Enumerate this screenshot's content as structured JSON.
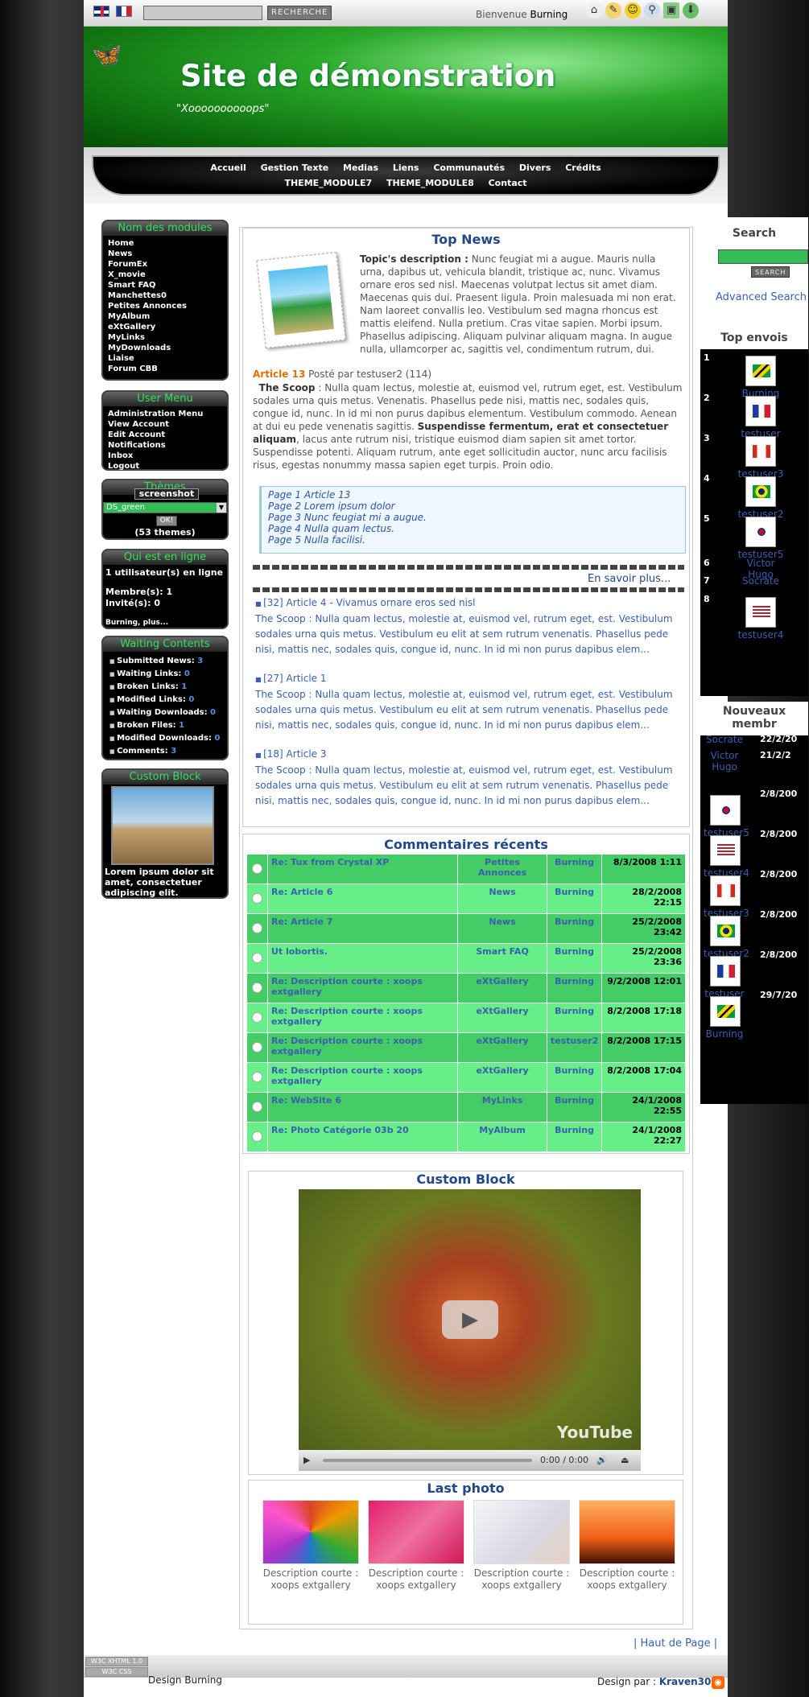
{
  "topbar": {
    "search_button": "RECHERCHE",
    "welcome_prefix": "Bienvenue",
    "welcome_user": "Burning",
    "icons": [
      "home-icon",
      "notes-icon",
      "smiley-icon",
      "search-icon",
      "image-icon",
      "download-icon"
    ]
  },
  "header": {
    "title": "Site de démonstration",
    "slogan": "\"Xoooooooooops\""
  },
  "nav": [
    "Accueil",
    "Gestion Texte",
    "Medias",
    "Liens",
    "Communautés",
    "Divers",
    "Crédits",
    "THEME_MODULE7",
    "THEME_MODULE8",
    "Contact"
  ],
  "modules": {
    "title": "Nom des modules",
    "items": [
      "Home",
      "News",
      "ForumEx",
      "X_movie",
      "Smart FAQ",
      "Manchettes0",
      "Petites Annonces",
      "MyAlbum",
      "eXtGallery",
      "MyLinks",
      "MyDownloads",
      "Liaise",
      "Forum CBB"
    ]
  },
  "usermenu": {
    "title": "User Menu",
    "items": [
      "Administration Menu",
      "View Account",
      "Edit Account",
      "Notifications",
      "Inbox",
      "Logout"
    ]
  },
  "themes": {
    "title": "Thèmes",
    "screenshot": "screenshot",
    "selected": "DS_green",
    "ok": "OK!",
    "count": "(53 themes)"
  },
  "online": {
    "title": "Qui est en ligne",
    "line1": "1 utilisateur(s) en ligne",
    "members": "Membre(s): 1",
    "guests": "Invité(s): 0",
    "users": "Burning, plus..."
  },
  "waiting": {
    "title": "Waiting Contents",
    "items": [
      {
        "label": "Submitted News:",
        "count": "3"
      },
      {
        "label": "Waiting Links:",
        "count": "0"
      },
      {
        "label": "Broken Links:",
        "count": "1"
      },
      {
        "label": "Modified Links:",
        "count": "0"
      },
      {
        "label": "Waiting Downloads:",
        "count": "0"
      },
      {
        "label": "Broken Files:",
        "count": "1"
      },
      {
        "label": "Modified Downloads:",
        "count": "0"
      },
      {
        "label": "Comments:",
        "count": "3"
      }
    ]
  },
  "customleft": {
    "title": "Custom Block",
    "text": "Lorem ipsum dolor sit amet, consectetuer adipiscing elit."
  },
  "topnews": {
    "title": "Top News",
    "desc_label": "Topic's description :",
    "desc": " Nunc feugiat mi a augue. Mauris nulla urna, dapibus ut, vehicula blandit, tristique ac, nunc. Vivamus ornare eros sed nisl. Maecenas volutpat lectus sit amet diam. Maecenas quis dui. Praesent ligula. Proin malesuada mi non erat. Nam laoreet convallis leo. Vestibulum sed magna rhoncus est mattis eleifend. Nulla pretium. Cras vitae sapien. Morbi ipsum. Phasellus adipiscing. Aliquam pulvinar aliquam magna. In augue nulla, ullamcorper ac, sagittis vel, condimentum rutrum, dui.",
    "article": "Article 13",
    "posted": " Posté par testuser2 (114)",
    "scoop_label": "The Scoop",
    "scoop": " : Nulla quam lectus, molestie at, euismod vel, rutrum eget, est. Vestibulum sodales urna quis metus. Venenatis. Phasellus pede nisi, mattis nec, sodales quis, congue id, nunc. In id mi non purus dapibus elementum. Vestibulum commodo. Aenean at dui eu pede venenatis sagittis. ",
    "scoop_bold": "Suspendisse fermentum, erat et consectetuer aliquam",
    "scoop_end": ", lacus ante rutrum nisi, tristique euismod diam sapien sit amet tortor. Suspendisse potenti. Aliquam rutrum, ante eget sollicitudin auctor, nunc arcu facilisis risus, egestas nonummy massa sapien eget turpis. Proin odio.",
    "pages": [
      "Page 1 Article 13",
      "Page 2 Lorem ipsum dolor",
      "Page 3 Nunc feugiat mi a augue.",
      "Page 4 Nulla quam lectus.",
      "Page 5 Nulla facilisi."
    ],
    "more": "En savoir plus...",
    "headlines": [
      {
        "title": "[32] Article 4 - Vivamus ornare eros sed nisl",
        "text": "The Scoop : Nulla quam lectus, molestie at, euismod vel, rutrum eget, est. Vestibulum sodales urna quis metus. Vestibulum eu elit at sem rutrum venenatis. Phasellus pede nisi, mattis nec, sodales quis, congue id, nunc. In id mi non purus dapibus elem..."
      },
      {
        "title": "[27] Article 1",
        "text": "The Scoop : Nulla quam lectus, molestie at, euismod vel, rutrum eget, est. Vestibulum sodales urna quis metus. Vestibulum eu elit at sem rutrum venenatis. Phasellus pede nisi, mattis nec, sodales quis, congue id, nunc. In id mi non purus dapibus elem..."
      },
      {
        "title": "[18] Article 3",
        "text": "The Scoop : Nulla quam lectus, molestie at, euismod vel, rutrum eget, est. Vestibulum sodales urna quis metus. Vestibulum eu elit at sem rutrum venenatis. Phasellus pede nisi, mattis nec, sodales quis, congue id, nunc. In id mi non purus dapibus elem..."
      }
    ]
  },
  "comments": {
    "title": "Commentaires récents",
    "rows": [
      {
        "title": "Re: Tux from Crystal XP",
        "module": "Petites Annonces",
        "user": "Burning",
        "date": "8/3/2008 1:11"
      },
      {
        "title": "Re: Article 6",
        "module": "News",
        "user": "Burning",
        "date": "28/2/2008 22:15"
      },
      {
        "title": "Re: Article 7",
        "module": "News",
        "user": "Burning",
        "date": "25/2/2008 23:42"
      },
      {
        "title": "Ut lobortis.",
        "module": "Smart FAQ",
        "user": "Burning",
        "date": "25/2/2008 23:36"
      },
      {
        "title": "Re: Description courte : xoops extgallery",
        "module": "eXtGallery",
        "user": "Burning",
        "date": "9/2/2008 12:01"
      },
      {
        "title": "Re: Description courte : xoops extgallery",
        "module": "eXtGallery",
        "user": "Burning",
        "date": "8/2/2008 17:18"
      },
      {
        "title": "Re: Description courte : xoops extgallery",
        "module": "eXtGallery",
        "user": "testuser2",
        "date": "8/2/2008 17:15"
      },
      {
        "title": "Re: Description courte : xoops extgallery",
        "module": "eXtGallery",
        "user": "Burning",
        "date": "8/2/2008 17:04"
      },
      {
        "title": "Re: WebSite 6",
        "module": "MyLinks",
        "user": "Burning",
        "date": "24/1/2008 22:55"
      },
      {
        "title": "Re: Photo Catégorie 03b 20",
        "module": "MyAlbum",
        "user": "Burning",
        "date": "24/1/2008 22:27"
      }
    ]
  },
  "customblock": {
    "title": "Custom Block",
    "video_brand": "YouTube",
    "video_time": "0:00 / 0:00"
  },
  "lastphoto": {
    "title": "Last photo",
    "photos": [
      {
        "caption": "Description courte : xoops extgallery"
      },
      {
        "caption": "Description courte : xoops extgallery"
      },
      {
        "caption": "Description courte : xoops extgallery"
      },
      {
        "caption": "Description courte : xoops extgallery"
      }
    ]
  },
  "right": {
    "search_title": "Search",
    "search_button": "SEARCH",
    "advanced": "Advanced Search",
    "topenvois_title": "Top envois",
    "topenvois": [
      {
        "rank": "1",
        "name": "Burning"
      },
      {
        "rank": "2",
        "name": "testuser"
      },
      {
        "rank": "3",
        "name": "testuser3"
      },
      {
        "rank": "4",
        "name": "testuser2"
      },
      {
        "rank": "5",
        "name": "testuser5"
      },
      {
        "rank": "6",
        "name": "Victor Hugo"
      },
      {
        "rank": "7",
        "name": "Socrate"
      },
      {
        "rank": "8",
        "name": "testuser4"
      }
    ],
    "nouveaux_title": "Nouveaux membr",
    "nouveaux": [
      {
        "name": "Socrate",
        "date": "22/2/20"
      },
      {
        "name": "Victor Hugo",
        "date": "21/2/2"
      },
      {
        "name": "testuser5",
        "date": "2/8/200"
      },
      {
        "name": "testuser4",
        "date": "2/8/200"
      },
      {
        "name": "testuser3",
        "date": "2/8/200"
      },
      {
        "name": "testuser2",
        "date": "2/8/200"
      },
      {
        "name": "testuser",
        "date": "2/8/200"
      },
      {
        "name": "Burning",
        "date": "29/7/20"
      }
    ]
  },
  "footer": {
    "top": "| Haut de Page |",
    "design": "Design Burning",
    "by_label": "Design par :",
    "by_name": "Kraven30",
    "w3c1": "W3C XHTML 1.0",
    "w3c2": "W3C CSS"
  }
}
